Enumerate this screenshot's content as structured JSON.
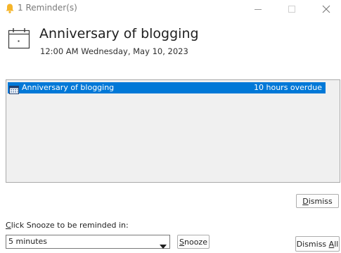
{
  "window": {
    "title": "1 Reminder(s)"
  },
  "header": {
    "subject": "Anniversary of blogging",
    "datetime": "12:00 AM Wednesday, May 10, 2023"
  },
  "reminders": [
    {
      "subject": "Anniversary of blogging",
      "due_in": "10 hours overdue",
      "selected": true
    }
  ],
  "buttons": {
    "dismiss": {
      "accel": "D",
      "rest": "ismiss"
    },
    "snooze": {
      "accel": "S",
      "rest": "nooze"
    },
    "dismiss_all": {
      "prefix": "Dismiss ",
      "accel": "A",
      "rest": "ll"
    }
  },
  "snooze": {
    "label_accel": "C",
    "label_rest": "lick Snooze to be reminded in:",
    "selected_value": "5 minutes"
  },
  "colors": {
    "selection": "#0078d7",
    "bell": "#f5b52a",
    "list_background": "#f0f0f0"
  },
  "icons": {
    "window": "bell-icon",
    "header": "calendar-icon",
    "row": "calendar-small-icon",
    "minimize": "minimize-icon",
    "maximize": "maximize-icon",
    "close": "close-icon",
    "dropdown": "chevron-down-icon"
  }
}
